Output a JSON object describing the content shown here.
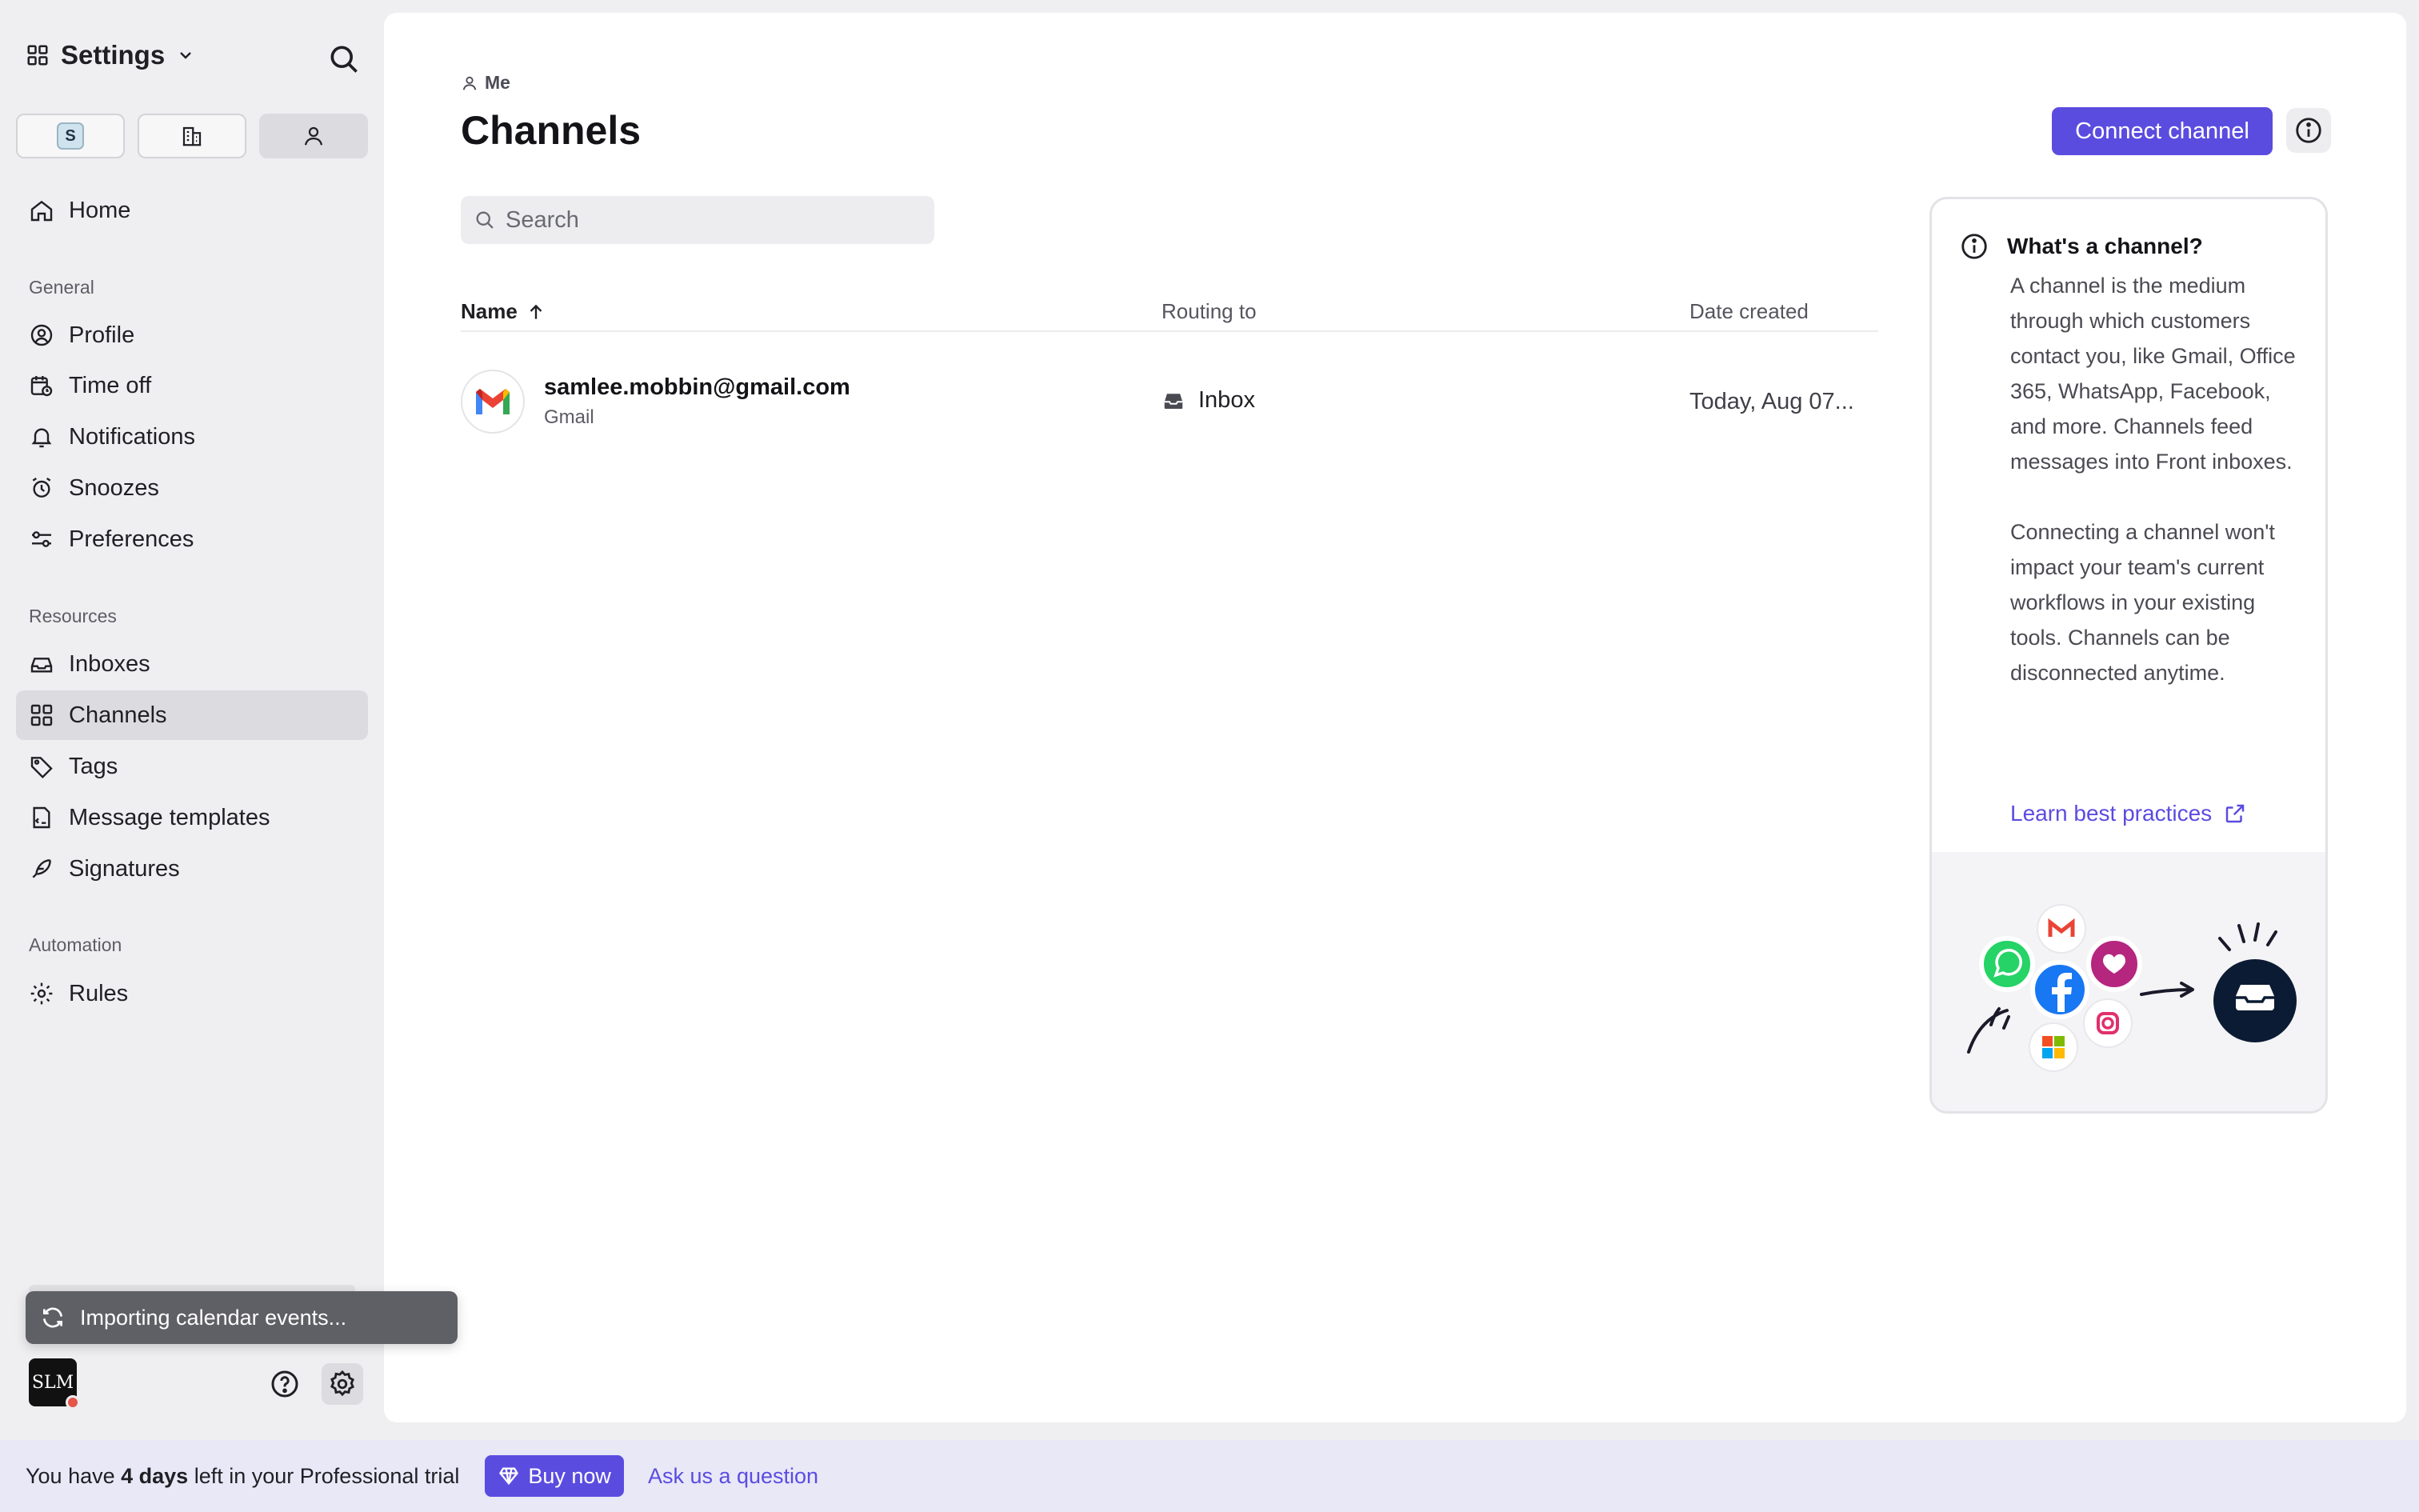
{
  "sidebar": {
    "title": "Settings",
    "segment_badge": "S",
    "items": {
      "home": "Home",
      "profile": "Profile",
      "time_off": "Time off",
      "notifications": "Notifications",
      "snoozes": "Snoozes",
      "preferences": "Preferences",
      "inboxes": "Inboxes",
      "channels": "Channels",
      "tags": "Tags",
      "message_templates": "Message templates",
      "signatures": "Signatures",
      "rules": "Rules"
    },
    "sections": {
      "general": "General",
      "resources": "Resources",
      "automation": "Automation"
    },
    "active_item": "Channels",
    "toast": "Importing calendar events...",
    "avatar_text": "SLM"
  },
  "main": {
    "breadcrumb": "Me",
    "title": "Channels",
    "connect_button": "Connect channel",
    "search_placeholder": "Search",
    "columns": {
      "name": "Name",
      "routing": "Routing to",
      "date": "Date created"
    },
    "rows": [
      {
        "email": "samlee.mobbin@gmail.com",
        "type": "Gmail",
        "routing": "Inbox",
        "date": "Today, Aug 07..."
      }
    ]
  },
  "help_card": {
    "title": "What's a channel?",
    "body": "A channel is the medium through which customers contact you, like Gmail, Office 365, WhatsApp, Facebook, and more. Channels feed messages into Front inboxes.\n\nConnecting a channel won't impact your team's current workflows in your existing tools. Channels can be disconnected anytime.",
    "link": "Learn best practices"
  },
  "trial_bar": {
    "prefix": "You have",
    "days": "4 days",
    "suffix": "left in your Professional trial",
    "buy": "Buy now",
    "ask": "Ask us a question"
  },
  "colors": {
    "accent": "#5b4ce0",
    "sidebar_bg": "#efeff1",
    "active_item_bg": "#dcdce0",
    "trial_bg": "#e8e8f7"
  }
}
